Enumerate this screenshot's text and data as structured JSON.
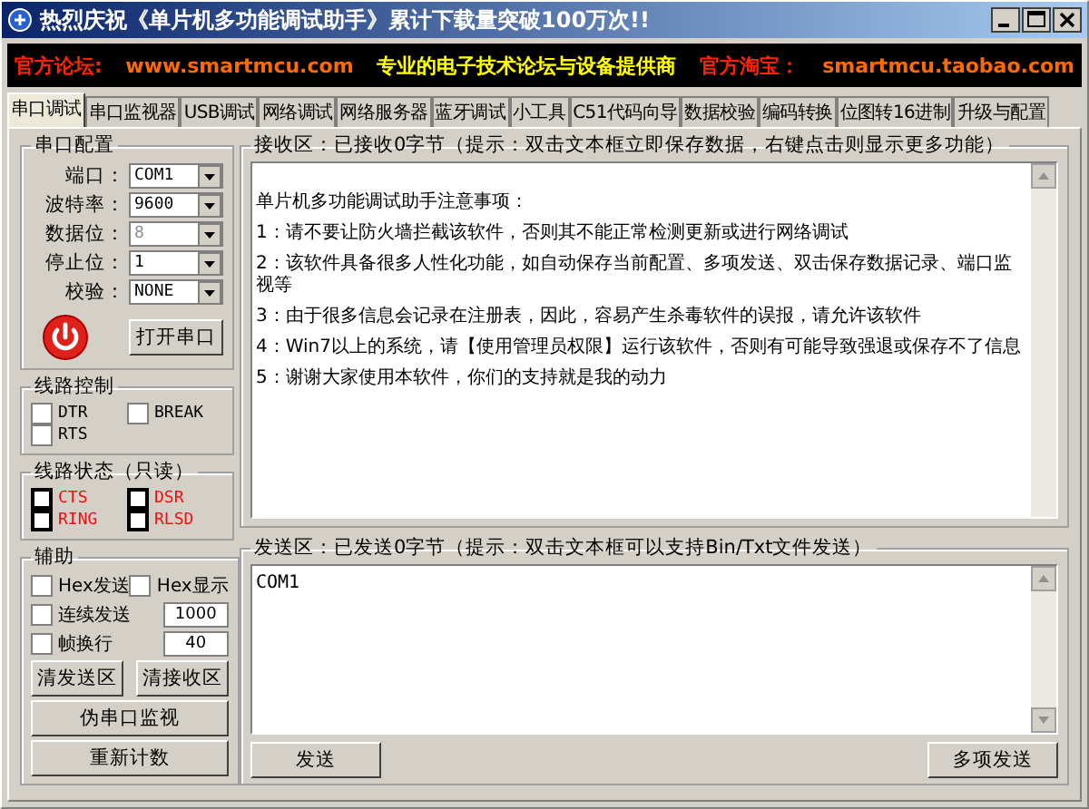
{
  "window": {
    "title": "热烈庆祝《单片机多功能调试助手》累计下载量突破100万次!!"
  },
  "banner": [
    {
      "text": "官方论坛:",
      "color": "#ff2200"
    },
    {
      "text": "www.smartmcu.com",
      "color": "#ff6a00"
    },
    {
      "text": "专业的电子技术论坛与设备提供商",
      "color": "#ffff00"
    },
    {
      "text": "官方淘宝：",
      "color": "#ff2200"
    },
    {
      "text": "smartmcu.taobao.com",
      "color": "#ff6a00"
    }
  ],
  "tabs": [
    {
      "label": "串口调试",
      "selected": true
    },
    {
      "label": "串口监视器",
      "selected": false
    },
    {
      "label": "USB调试",
      "selected": false
    },
    {
      "label": "网络调试",
      "selected": false
    },
    {
      "label": "网络服务器",
      "selected": false
    },
    {
      "label": "蓝牙调试",
      "selected": false
    },
    {
      "label": "小工具",
      "selected": false
    },
    {
      "label": "C51代码向导",
      "selected": false
    },
    {
      "label": "数据校验",
      "selected": false
    },
    {
      "label": "编码转换",
      "selected": false
    },
    {
      "label": "位图转16进制",
      "selected": false
    },
    {
      "label": "升级与配置",
      "selected": false
    }
  ],
  "serial_config": {
    "title": "串口配置",
    "fields": [
      {
        "label": "端口：",
        "value": "COM1",
        "disabled": false
      },
      {
        "label": "波特率：",
        "value": "9600",
        "disabled": false
      },
      {
        "label": "数据位：",
        "value": "8",
        "disabled": true
      },
      {
        "label": "停止位：",
        "value": "1",
        "disabled": false
      },
      {
        "label": "校验：",
        "value": "NONE",
        "disabled": false
      }
    ],
    "open_button": "打开串口"
  },
  "line_control": {
    "title": "线路控制",
    "items": [
      {
        "label": "DTR",
        "checked": false
      },
      {
        "label": "BREAK",
        "checked": false
      },
      {
        "label": "RTS",
        "checked": false
      }
    ]
  },
  "line_status": {
    "title": "线路状态（只读）",
    "items": [
      {
        "label": "CTS",
        "on": false
      },
      {
        "label": "DSR",
        "on": false
      },
      {
        "label": "RING",
        "on": false
      },
      {
        "label": "RLSD",
        "on": false
      }
    ]
  },
  "assist": {
    "title": "辅助",
    "options": [
      {
        "label": "Hex发送",
        "checked": false
      },
      {
        "label": "Hex显示",
        "checked": false
      }
    ],
    "inputs": [
      {
        "label": "连续发送",
        "checked": false,
        "value": "1000"
      },
      {
        "label": "帧换行",
        "checked": false,
        "value": "40"
      }
    ],
    "small_buttons": [
      "清发送区",
      "清接收区"
    ],
    "buttons": [
      "伪串口监视",
      "重新计数"
    ]
  },
  "receive": {
    "title": "接收区：已接收0字节（提示：双击文本框立即保存数据，右键点击则显示更多功能）",
    "lines": [
      "单片机多功能调试助手注意事项：",
      "1：请不要让防火墙拦截该软件，否则其不能正常检测更新或进行网络调试",
      "2：该软件具备很多人性化功能，如自动保存当前配置、多项发送、双击保存数据记录、端口监视等",
      "3：由于很多信息会记录在注册表，因此，容易产生杀毒软件的误报，请允许该软件",
      "4：Win7以上的系统，请【使用管理员权限】运行该软件，否则有可能导致强退或保存不了信息",
      "5：谢谢大家使用本软件，你们的支持就是我的动力"
    ]
  },
  "send": {
    "title": "发送区：已发送0字节（提示：双击文本框可以支持Bin/Txt文件发送）",
    "value": "COM1",
    "buttons": [
      "发送",
      "多项发送"
    ]
  }
}
